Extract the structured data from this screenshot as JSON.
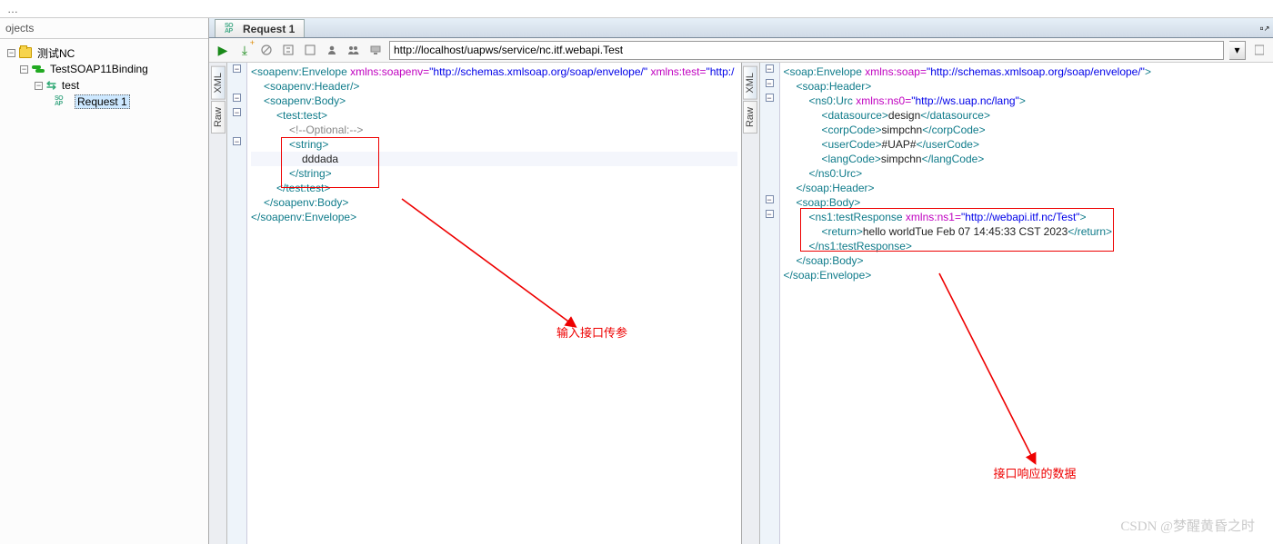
{
  "sidebar": {
    "title": "ojects",
    "items": [
      {
        "label": "测试NC",
        "icon": "folder"
      },
      {
        "label": "TestSOAP11Binding",
        "icon": "iface"
      },
      {
        "label": "test",
        "icon": "iface2"
      },
      {
        "label": "Request 1",
        "icon": "soap",
        "selected": true
      }
    ]
  },
  "tab": {
    "label": "Request 1",
    "soap_icon": "SO\nAP"
  },
  "toolbar": {
    "url": "http://localhost/uapws/service/nc.itf.webapi.Test"
  },
  "side_tabs": {
    "xml": "XML",
    "raw": "Raw"
  },
  "request_xml": {
    "lines": [
      {
        "i": 0,
        "parts": [
          [
            "tag",
            "<soapenv:Envelope"
          ],
          [
            "txt",
            " "
          ],
          [
            "attr",
            "xmlns:soapenv="
          ],
          [
            "val",
            "\"http://schemas.xmlsoap.org/soap/envelope/\""
          ],
          [
            "txt",
            " "
          ],
          [
            "attr",
            "xmlns:test="
          ],
          [
            "val",
            "\"http:/"
          ]
        ]
      },
      {
        "i": 1,
        "parts": [
          [
            "tag",
            "<soapenv:Header/>"
          ]
        ]
      },
      {
        "i": 1,
        "parts": [
          [
            "tag",
            "<soapenv:Body>"
          ]
        ]
      },
      {
        "i": 2,
        "parts": [
          [
            "tag",
            "<test:test>"
          ]
        ]
      },
      {
        "i": 3,
        "parts": [
          [
            "cm",
            "<!--Optional:-->"
          ]
        ]
      },
      {
        "i": 3,
        "parts": [
          [
            "tag",
            "<string>"
          ]
        ]
      },
      {
        "i": 4,
        "hl": true,
        "parts": [
          [
            "txt",
            "dddada"
          ]
        ]
      },
      {
        "i": 3,
        "parts": [
          [
            "tag",
            "</string>"
          ]
        ]
      },
      {
        "i": 2,
        "parts": [
          [
            "tag",
            "</test:test>"
          ]
        ]
      },
      {
        "i": 1,
        "parts": [
          [
            "tag",
            "</soapenv:Body>"
          ]
        ]
      },
      {
        "i": 0,
        "parts": [
          [
            "tag",
            "</soapenv:Envelope>"
          ]
        ]
      }
    ]
  },
  "response_xml": {
    "lines": [
      {
        "i": 0,
        "parts": [
          [
            "tag",
            "<soap:Envelope"
          ],
          [
            "txt",
            " "
          ],
          [
            "attr",
            "xmlns:soap="
          ],
          [
            "val",
            "\"http://schemas.xmlsoap.org/soap/envelope/\""
          ],
          [
            "tag",
            ">"
          ]
        ]
      },
      {
        "i": 1,
        "parts": [
          [
            "tag",
            "<soap:Header>"
          ]
        ]
      },
      {
        "i": 2,
        "parts": [
          [
            "tag",
            "<ns0:Urc"
          ],
          [
            "txt",
            " "
          ],
          [
            "attr",
            "xmlns:ns0="
          ],
          [
            "val",
            "\"http://ws.uap.nc/lang\""
          ],
          [
            "tag",
            ">"
          ]
        ]
      },
      {
        "i": 3,
        "parts": [
          [
            "tag",
            "<datasource>"
          ],
          [
            "txt",
            "design"
          ],
          [
            "tag",
            "</datasource>"
          ]
        ]
      },
      {
        "i": 3,
        "parts": [
          [
            "tag",
            "<corpCode>"
          ],
          [
            "txt",
            "simpchn"
          ],
          [
            "tag",
            "</corpCode>"
          ]
        ]
      },
      {
        "i": 3,
        "parts": [
          [
            "tag",
            "<userCode>"
          ],
          [
            "txt",
            "#UAP#"
          ],
          [
            "tag",
            "</userCode>"
          ]
        ]
      },
      {
        "i": 3,
        "parts": [
          [
            "tag",
            "<langCode>"
          ],
          [
            "txt",
            "simpchn"
          ],
          [
            "tag",
            "</langCode>"
          ]
        ]
      },
      {
        "i": 2,
        "parts": [
          [
            "tag",
            "</ns0:Urc>"
          ]
        ]
      },
      {
        "i": 1,
        "parts": [
          [
            "tag",
            "</soap:Header>"
          ]
        ]
      },
      {
        "i": 1,
        "parts": [
          [
            "tag",
            "<soap:Body>"
          ]
        ]
      },
      {
        "i": 2,
        "parts": [
          [
            "tag",
            "<ns1:testResponse"
          ],
          [
            "txt",
            " "
          ],
          [
            "attr",
            "xmlns:ns1="
          ],
          [
            "val",
            "\"http://webapi.itf.nc/Test\""
          ],
          [
            "tag",
            ">"
          ]
        ]
      },
      {
        "i": 3,
        "parts": [
          [
            "tag",
            "<return>"
          ],
          [
            "txt",
            "hello worldTue Feb 07 14:45:33 CST 2023"
          ],
          [
            "tag",
            "</return>"
          ]
        ]
      },
      {
        "i": 2,
        "parts": [
          [
            "tag",
            "</ns1:testResponse>"
          ]
        ]
      },
      {
        "i": 1,
        "parts": [
          [
            "tag",
            "</soap:Body>"
          ]
        ]
      },
      {
        "i": 0,
        "parts": [
          [
            "tag",
            "</soap:Envelope>"
          ]
        ]
      }
    ]
  },
  "annotations": {
    "left_label": "输入接口传参",
    "right_label": "接口响应的数据"
  },
  "watermark": "CSDN @梦醒黄昏之时"
}
